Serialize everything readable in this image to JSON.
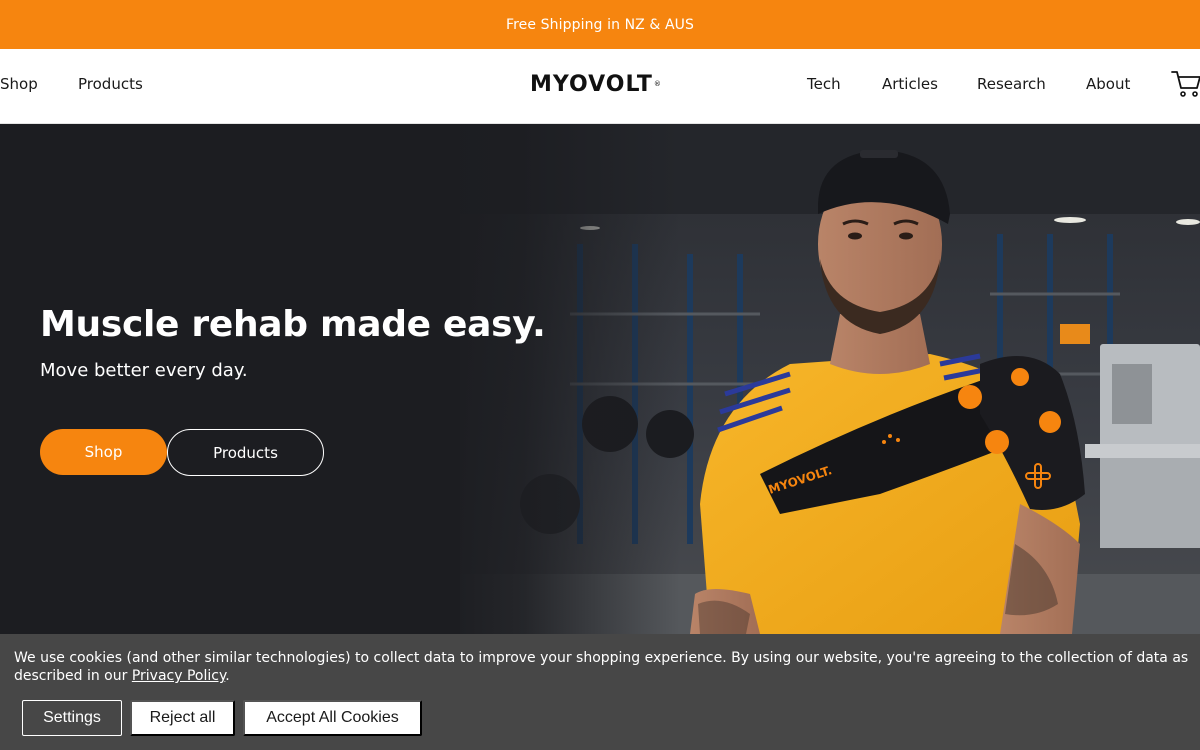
{
  "announcement": {
    "text": "Free Shipping in NZ & AUS"
  },
  "header": {
    "nav_left": [
      "Shop",
      "Products"
    ],
    "logo_text": "MYOVOLT",
    "logo_mark": "®",
    "nav_right": [
      "Tech",
      "Articles",
      "Research",
      "About"
    ],
    "cart_icon": "cart-icon"
  },
  "hero": {
    "title": "Muscle rehab made easy.",
    "subtitle": "Move better every day.",
    "primary_button": "Shop",
    "secondary_button": "Products",
    "device_brand": "MYOVOLT."
  },
  "cookie_banner": {
    "text_before_link": "We use cookies (and other similar technologies) to collect data to improve your shopping experience. By using our website, you're agreeing to the collection of data as described in our ",
    "link_text": "Privacy Policy",
    "text_after_link": ".",
    "settings_button": "Settings",
    "reject_button": "Reject all",
    "accept_button": "Accept All Cookies"
  },
  "colors": {
    "brand_orange": "#f6850f",
    "hero_background": "#1c1d21",
    "cookie_background": "#474747"
  }
}
